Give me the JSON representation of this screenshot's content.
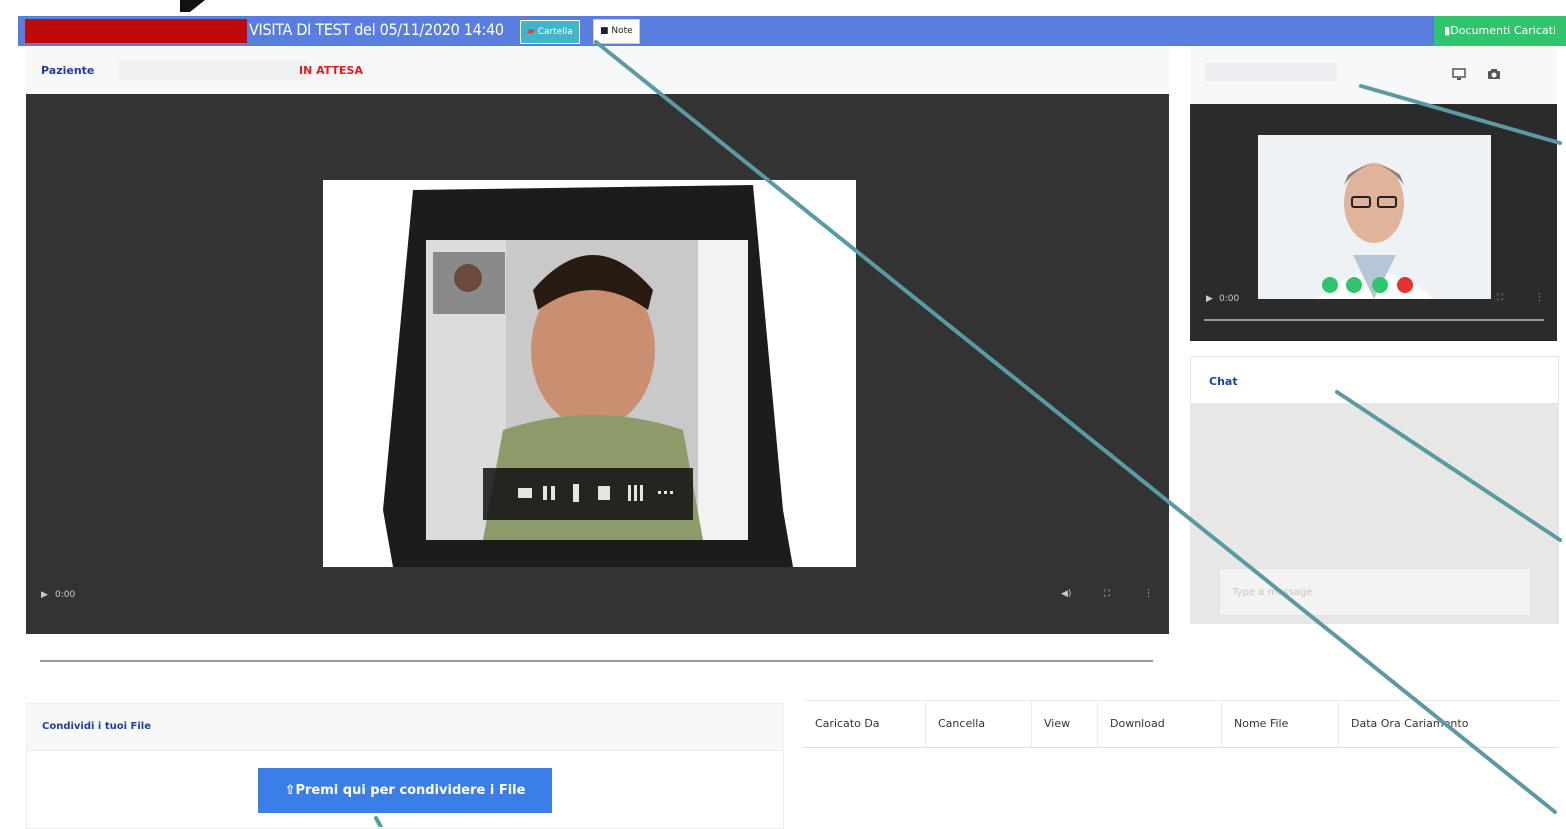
{
  "header": {
    "visit_title": "VISITA DI TEST del 05/11/2020 14:40",
    "cartella_label": "Cartella",
    "note_label": "Note",
    "documents_label": "Documenti Caricati"
  },
  "patient": {
    "label": "Paziente",
    "status": "IN ATTESA"
  },
  "main_video": {
    "time": "0:00"
  },
  "doctor_video": {
    "time": "0:00"
  },
  "chat": {
    "title": "Chat",
    "placeholder": "Type a message"
  },
  "share": {
    "title": "Condividi i tuoi File",
    "button_label": "Premi qui per condividere i File"
  },
  "files_table": {
    "columns": [
      "Caricato Da",
      "Cancella",
      "View",
      "Download",
      "Nome File",
      "Data Ora Cariamento"
    ]
  },
  "colors": {
    "topbar": "#5a7ee0",
    "status_red": "#e11c1c",
    "label_blue": "#1f3fa0",
    "docs_green": "#2fc56c",
    "annotation_teal": "#5a9aa0"
  }
}
